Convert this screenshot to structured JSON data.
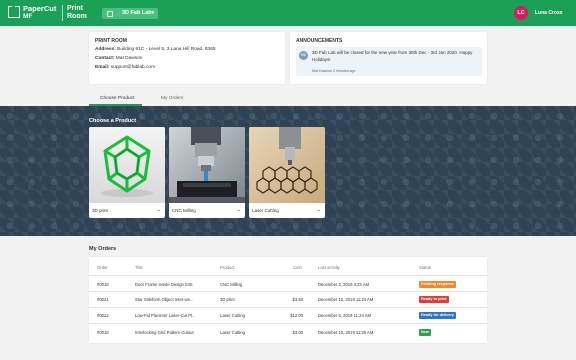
{
  "header": {
    "brand_line1": "PaperCut",
    "brand_line2": "MF",
    "product_line1": "Print",
    "product_line2": "Room",
    "room": "3D Fab Lab",
    "avatar_initials": "LC",
    "user_name": "Luna Cross",
    "brand_color": "#1aa157"
  },
  "print_room": {
    "title": "PRINT ROOM",
    "address_label": "Address:",
    "address": "Building 61C - Level 5, 3 Lana Hill Road, 9365",
    "contact_label": "Contact:",
    "contact": "Mat Dawson",
    "email_label": "Email:",
    "email": "support@fablab.com"
  },
  "announcements": {
    "title": "ANNOUNCEMENTS",
    "avatar_initials": "MD",
    "text": "3D Fab Lab will be closed for the new year from 30th Dec - 3rd Jan 2020. Happy Holidays!",
    "meta": "Mat Dawson  2 minutes ago"
  },
  "tabs": [
    {
      "label": "Choose Product",
      "active": true
    },
    {
      "label": "My Orders",
      "active": false
    }
  ],
  "products_section": {
    "title": "Choose a Product",
    "products": [
      {
        "label": "3D print",
        "image": "green-3d-printed-lattice-image"
      },
      {
        "label": "CNC Milling",
        "image": "cnc-milling-machine-image"
      },
      {
        "label": "Laser Cutting",
        "image": "laser-cut-hexagon-pattern-image"
      }
    ]
  },
  "orders": {
    "title": "My Orders",
    "columns": [
      "Order",
      "Title",
      "Product",
      "Cost",
      "Last activity",
      "Status"
    ],
    "rows": [
      {
        "order": "#0018",
        "title": "Door Frame Inside Design 03S",
        "product": "CNC Milling",
        "cost": "",
        "last_activity": "December 2, 2019 3:23 AM",
        "status": "Pending response",
        "status_color": "#f0892b"
      },
      {
        "order": "#0021",
        "title": "Star Stileform Object Inter-we...",
        "product": "3D print",
        "cost": "$3.50",
        "last_activity": "December 10, 2019 11:24 AM",
        "status": "Ready to print",
        "status_color": "#e23b3b"
      },
      {
        "order": "#0022",
        "title": "Low-Fid Planimer Laser-Cut Pl...",
        "product": "Laser Cutting",
        "cost": "$12.00",
        "last_activity": "December 5, 2019 11:24 AM",
        "status": "Ready for delivery",
        "status_color": "#2f74c9"
      },
      {
        "order": "#0018",
        "title": "Interlocking Grid Pattern Cutout",
        "product": "Laser Cutting",
        "cost": "$3.00",
        "last_activity": "December 10, 2019 11:28 AM",
        "status": "New",
        "status_color": "#2aa44f"
      }
    ]
  }
}
